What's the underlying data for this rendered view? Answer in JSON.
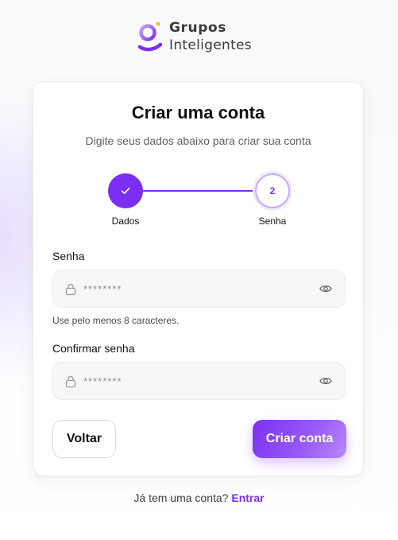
{
  "brand": {
    "name_line1": "Grupos",
    "name_line2": "Inteligentes",
    "logo_icon": "g-logo-icon",
    "accent_color": "#7b2ff2",
    "logo_dot_color": "#f2c230"
  },
  "card": {
    "title": "Criar uma conta",
    "subtitle": "Digite seus dados abaixo para criar sua conta"
  },
  "stepper": {
    "current_step": 2,
    "steps": [
      {
        "label": "Dados",
        "state": "completed",
        "icon": "check-icon"
      },
      {
        "label": "Senha",
        "number": "2",
        "state": "active"
      }
    ]
  },
  "form": {
    "password": {
      "label": "Senha",
      "placeholder": "********",
      "value": "",
      "hint": "Use pelo menos 8 caracteres.",
      "icon_left": "lock-icon",
      "icon_right": "eye-icon"
    },
    "confirm_password": {
      "label": "Confirmar senha",
      "placeholder": "********",
      "value": "",
      "icon_left": "lock-icon",
      "icon_right": "eye-icon"
    }
  },
  "actions": {
    "back_label": "Voltar",
    "submit_label": "Criar conta"
  },
  "footer": {
    "text": "Já tem uma conta?",
    "link_label": "Entrar"
  }
}
